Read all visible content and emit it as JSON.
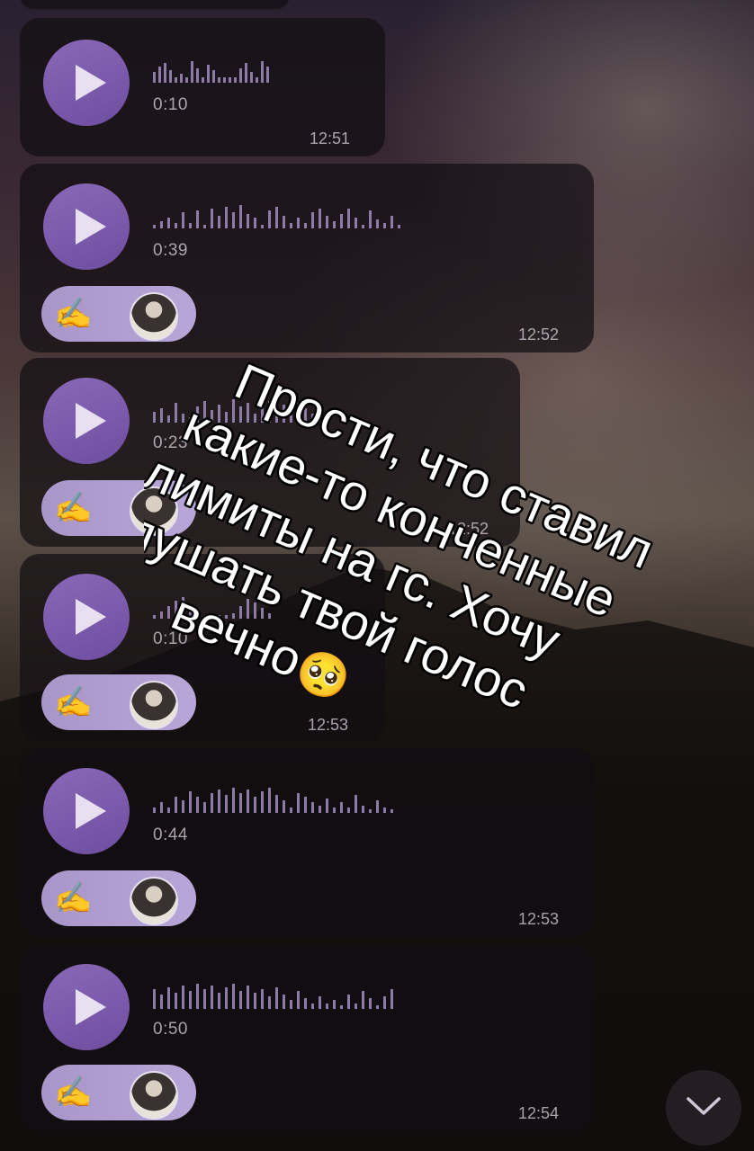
{
  "messages": [
    {
      "duration": "0:10",
      "time": "12:51",
      "reactions": false
    },
    {
      "duration": "0:39",
      "time": "12:52",
      "reactions": true
    },
    {
      "duration": "0:23",
      "time": "12:52",
      "reactions": true
    },
    {
      "duration": "0:10",
      "time": "12:53",
      "reactions": true
    },
    {
      "duration": "0:44",
      "time": "12:53",
      "reactions": true
    },
    {
      "duration": "0:50",
      "time": "12:54",
      "reactions": true
    }
  ],
  "reaction_emoji": "✍️",
  "overlay_text": {
    "line1": "Прости, что ставил",
    "line2": "какие-то конченные",
    "line3": "лимиты на гс. Хочу",
    "line4": "слушать твой голос",
    "line5": "вечно",
    "emoji": "🥺"
  },
  "colors": {
    "play_accent": "#7a5aac",
    "reaction_bg": "#b3a2d4"
  },
  "icons": {
    "play": "play-icon",
    "scroll_down": "chevron-down-icon"
  }
}
